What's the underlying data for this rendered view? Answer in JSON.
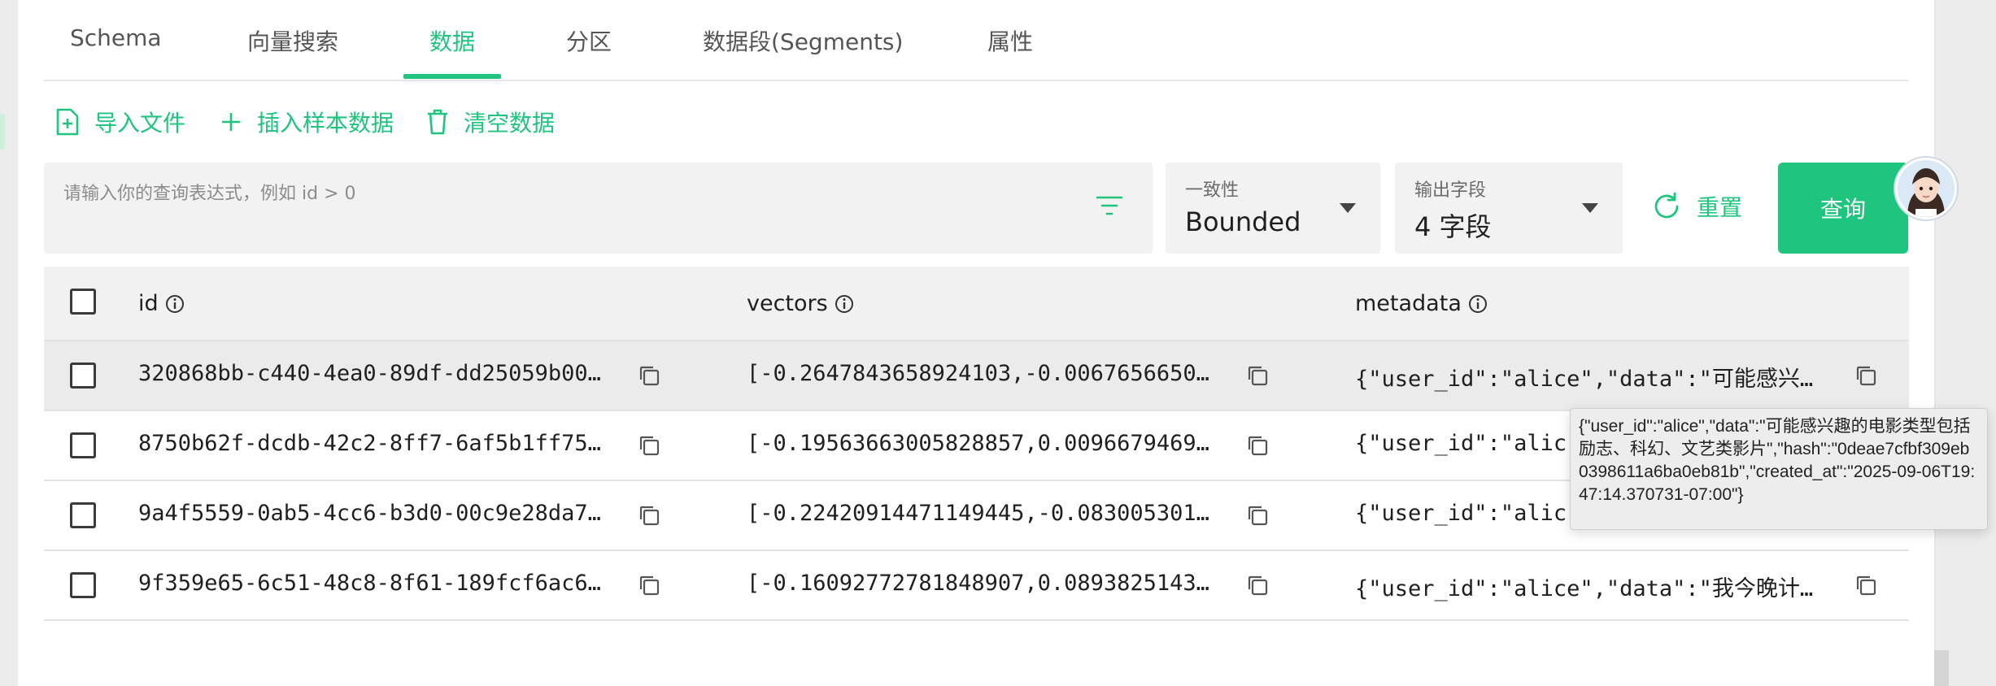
{
  "tabs": [
    {
      "label": "Schema",
      "active": false
    },
    {
      "label": "向量搜索",
      "active": false
    },
    {
      "label": "数据",
      "active": true
    },
    {
      "label": "分区",
      "active": false
    },
    {
      "label": "数据段(Segments)",
      "active": false
    },
    {
      "label": "属性",
      "active": false
    }
  ],
  "actions": {
    "import_file": "导入文件",
    "insert_sample": "插入样本数据",
    "clear_data": "清空数据"
  },
  "query": {
    "placeholder": "请输入你的查询表达式，例如 id > 0"
  },
  "consistency": {
    "label": "一致性",
    "value": "Bounded"
  },
  "output_fields": {
    "label": "输出字段",
    "value": "4 字段"
  },
  "buttons": {
    "reset": "重置",
    "query": "查询"
  },
  "table": {
    "columns": [
      "id",
      "vectors",
      "metadata"
    ],
    "rows": [
      {
        "id": "320868bb-c440-4ea0-89df-dd25059b00…",
        "vectors": "[-0.2647843658924103,-0.0067656650…",
        "metadata": "{\"user_id\":\"alice\",\"data\":\"可能感兴…",
        "hover": true
      },
      {
        "id": "8750b62f-dcdb-42c2-8ff7-6af5b1ff75…",
        "vectors": "[-0.19563663005828857,0.0096679469…",
        "metadata": "{\"user_id\":\"alic",
        "hover": false
      },
      {
        "id": "9a4f5559-0ab5-4cc6-b3d0-00c9e28da7…",
        "vectors": "[-0.22420914471149445,-0.083005301…",
        "metadata": "{\"user_id\":\"alic",
        "hover": false
      },
      {
        "id": "9f359e65-6c51-48c8-8f61-189fcf6ac6…",
        "vectors": "[-0.16092772781848907,0.0893825143…",
        "metadata": "{\"user_id\":\"alice\",\"data\":\"我今晚计…",
        "hover": false
      }
    ]
  },
  "tooltip": {
    "text": "{\"user_id\":\"alice\",\"data\":\"可能感兴趣的电影类型包括励志、科幻、文艺类影片\",\"hash\":\"0deae7cfbf309eb0398611a6ba0eb81b\",\"created_at\":\"2025-09-06T19:47:14.370731-07:00\"}"
  },
  "colors": {
    "accent": "#1fc47e"
  },
  "icons": [
    "file-plus-icon",
    "plus-icon",
    "trash-icon",
    "filter-icon",
    "caret-down-icon",
    "reset-icon",
    "info-icon",
    "copy-icon",
    "user-avatar"
  ]
}
